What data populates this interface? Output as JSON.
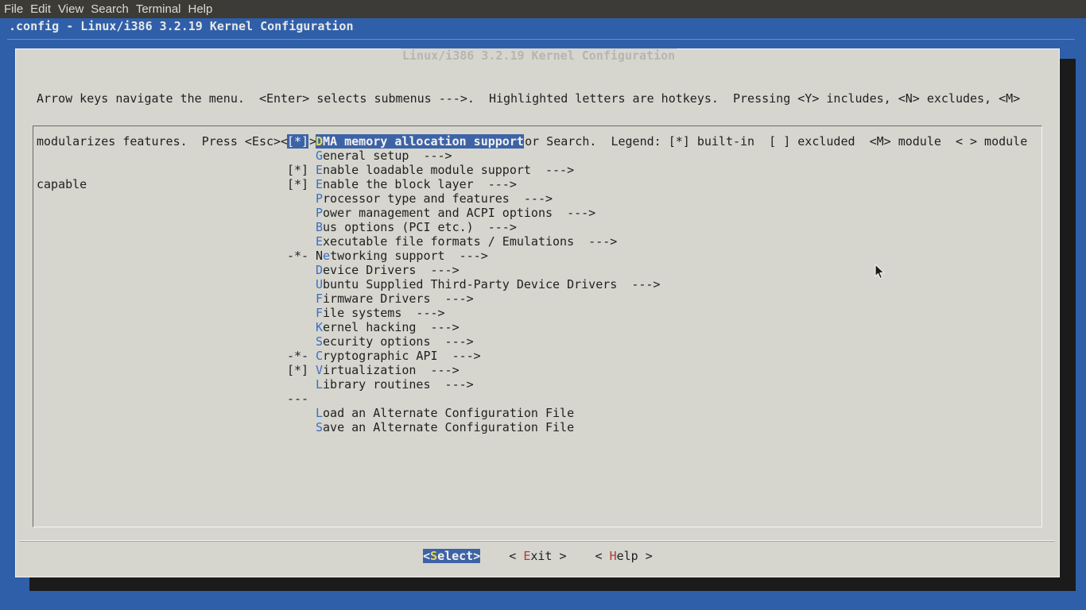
{
  "menubar": {
    "items": [
      "File",
      "Edit",
      "View",
      "Search",
      "Terminal",
      "Help"
    ]
  },
  "terminal": {
    "title": ".config - Linux/i386 3.2.19 Kernel Configuration"
  },
  "dialog": {
    "title": "Linux/i386 3.2.19 Kernel Configuration",
    "help_lines": [
      "Arrow keys navigate the menu.  <Enter> selects submenus --->.  Highlighted letters are hotkeys.  Pressing <Y> includes, <N> excludes, <M>",
      "modularizes features.  Press <Esc><Esc> to exit, <?> for Help, </> for Search.  Legend: [*] built-in  [ ] excluded  <M> module  < > module",
      "capable"
    ],
    "menu": [
      {
        "prefix": "[*]",
        "hotkey": "D",
        "rest": "MA memory allocation support",
        "selected": true
      },
      {
        "prefix": "",
        "hotkey": "G",
        "rest": "eneral setup  --->"
      },
      {
        "prefix": "[*]",
        "hotkey": "E",
        "rest": "nable loadable module support  --->"
      },
      {
        "prefix": "[*]",
        "hotkey": "E",
        "rest": "nable the block layer  --->"
      },
      {
        "prefix": "",
        "hotkey": "P",
        "rest": "rocessor type and features  --->"
      },
      {
        "prefix": "",
        "hotkey": "P",
        "rest": "ower management and ACPI options  --->"
      },
      {
        "prefix": "",
        "hotkey": "B",
        "rest": "us options (PCI etc.)  --->"
      },
      {
        "prefix": "",
        "hotkey": "E",
        "rest": "xecutable file formats / Emulations  --->"
      },
      {
        "prefix": "-*-",
        "pre": "N",
        "hotkey": "e",
        "rest": "tworking support  --->"
      },
      {
        "prefix": "",
        "hotkey": "D",
        "rest": "evice Drivers  --->"
      },
      {
        "prefix": "",
        "hotkey": "U",
        "rest": "buntu Supplied Third-Party Device Drivers  --->"
      },
      {
        "prefix": "",
        "hotkey": "F",
        "rest": "irmware Drivers  --->"
      },
      {
        "prefix": "",
        "hotkey": "F",
        "rest": "ile systems  --->"
      },
      {
        "prefix": "",
        "hotkey": "K",
        "rest": "ernel hacking  --->"
      },
      {
        "prefix": "",
        "hotkey": "S",
        "rest": "ecurity options  --->"
      },
      {
        "prefix": "-*-",
        "hotkey": "C",
        "rest": "ryptographic API  --->"
      },
      {
        "prefix": "[*]",
        "hotkey": "V",
        "rest": "irtualization  --->"
      },
      {
        "prefix": "",
        "hotkey": "L",
        "rest": "ibrary routines  --->"
      },
      {
        "prefix": "---",
        "hotkey": "",
        "rest": ""
      },
      {
        "prefix": "",
        "hotkey": "L",
        "rest": "oad an Alternate Configuration File"
      },
      {
        "prefix": "",
        "hotkey": "S",
        "rest": "ave an Alternate Configuration File"
      }
    ],
    "buttons": {
      "select": {
        "open": "<",
        "hotkey": "S",
        "rest": "elect",
        "close": ">"
      },
      "exit": {
        "open": "< ",
        "hotkey": "E",
        "rest": "xit",
        "close": " >"
      },
      "help": {
        "open": "< ",
        "hotkey": "H",
        "rest": "elp",
        "close": " >"
      }
    }
  },
  "colors": {
    "terminal_bg": "#2f5fa8",
    "dialog_bg": "#d6d6cf",
    "selection": "#3d63a6",
    "hotkey": "#3a6fc0",
    "hotkey_selected": "#e8d84a",
    "button_hotkey": "#b23a2a"
  },
  "icons": {
    "cursor": "mouse-pointer-icon"
  }
}
